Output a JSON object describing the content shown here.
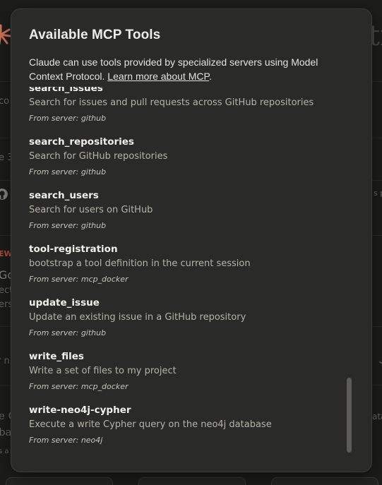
{
  "modal": {
    "title": "Available MCP Tools",
    "description_prefix": "Claude can use tools provided by specialized servers using Model Context Protocol.",
    "learn_more_link": "Learn more about MCP",
    "description_suffix": "."
  },
  "tools": [
    {
      "name": "search_issues",
      "description": "Search for issues and pull requests across GitHub repositories",
      "server": "From server: github"
    },
    {
      "name": "search_repositories",
      "description": "Search for GitHub repositories",
      "server": "From server: github"
    },
    {
      "name": "search_users",
      "description": "Search for users on GitHub",
      "server": "From server: github"
    },
    {
      "name": "tool-registration",
      "description": "bootstrap a tool definition in the current session",
      "server": "From server: mcp_docker"
    },
    {
      "name": "update_issue",
      "description": "Update an existing issue in a GitHub repository",
      "server": "From server: github"
    },
    {
      "name": "write_files",
      "description": "Write a set of files to my project",
      "server": "From server: mcp_docker"
    },
    {
      "name": "write-neo4j-cypher",
      "description": "Execute a write Cypher query on the neo4j database",
      "server": "From server: neo4j"
    }
  ],
  "background": {
    "fragments": [
      "ti",
      "co",
      "e 3",
      "s pr",
      "EW",
      "Go",
      "ect",
      "ers",
      "r n",
      "e C",
      "bas",
      "s a",
      "ata"
    ]
  },
  "colors": {
    "page_background": "#1d1d1b",
    "modal_background": "#2a2a28",
    "accent_orange": "#d97757",
    "text_primary": "#f0efea",
    "text_secondary": "#b5b3aa"
  },
  "icons": {
    "background_logo": "claude-starburst-icon",
    "background_repo": "github-icon"
  }
}
